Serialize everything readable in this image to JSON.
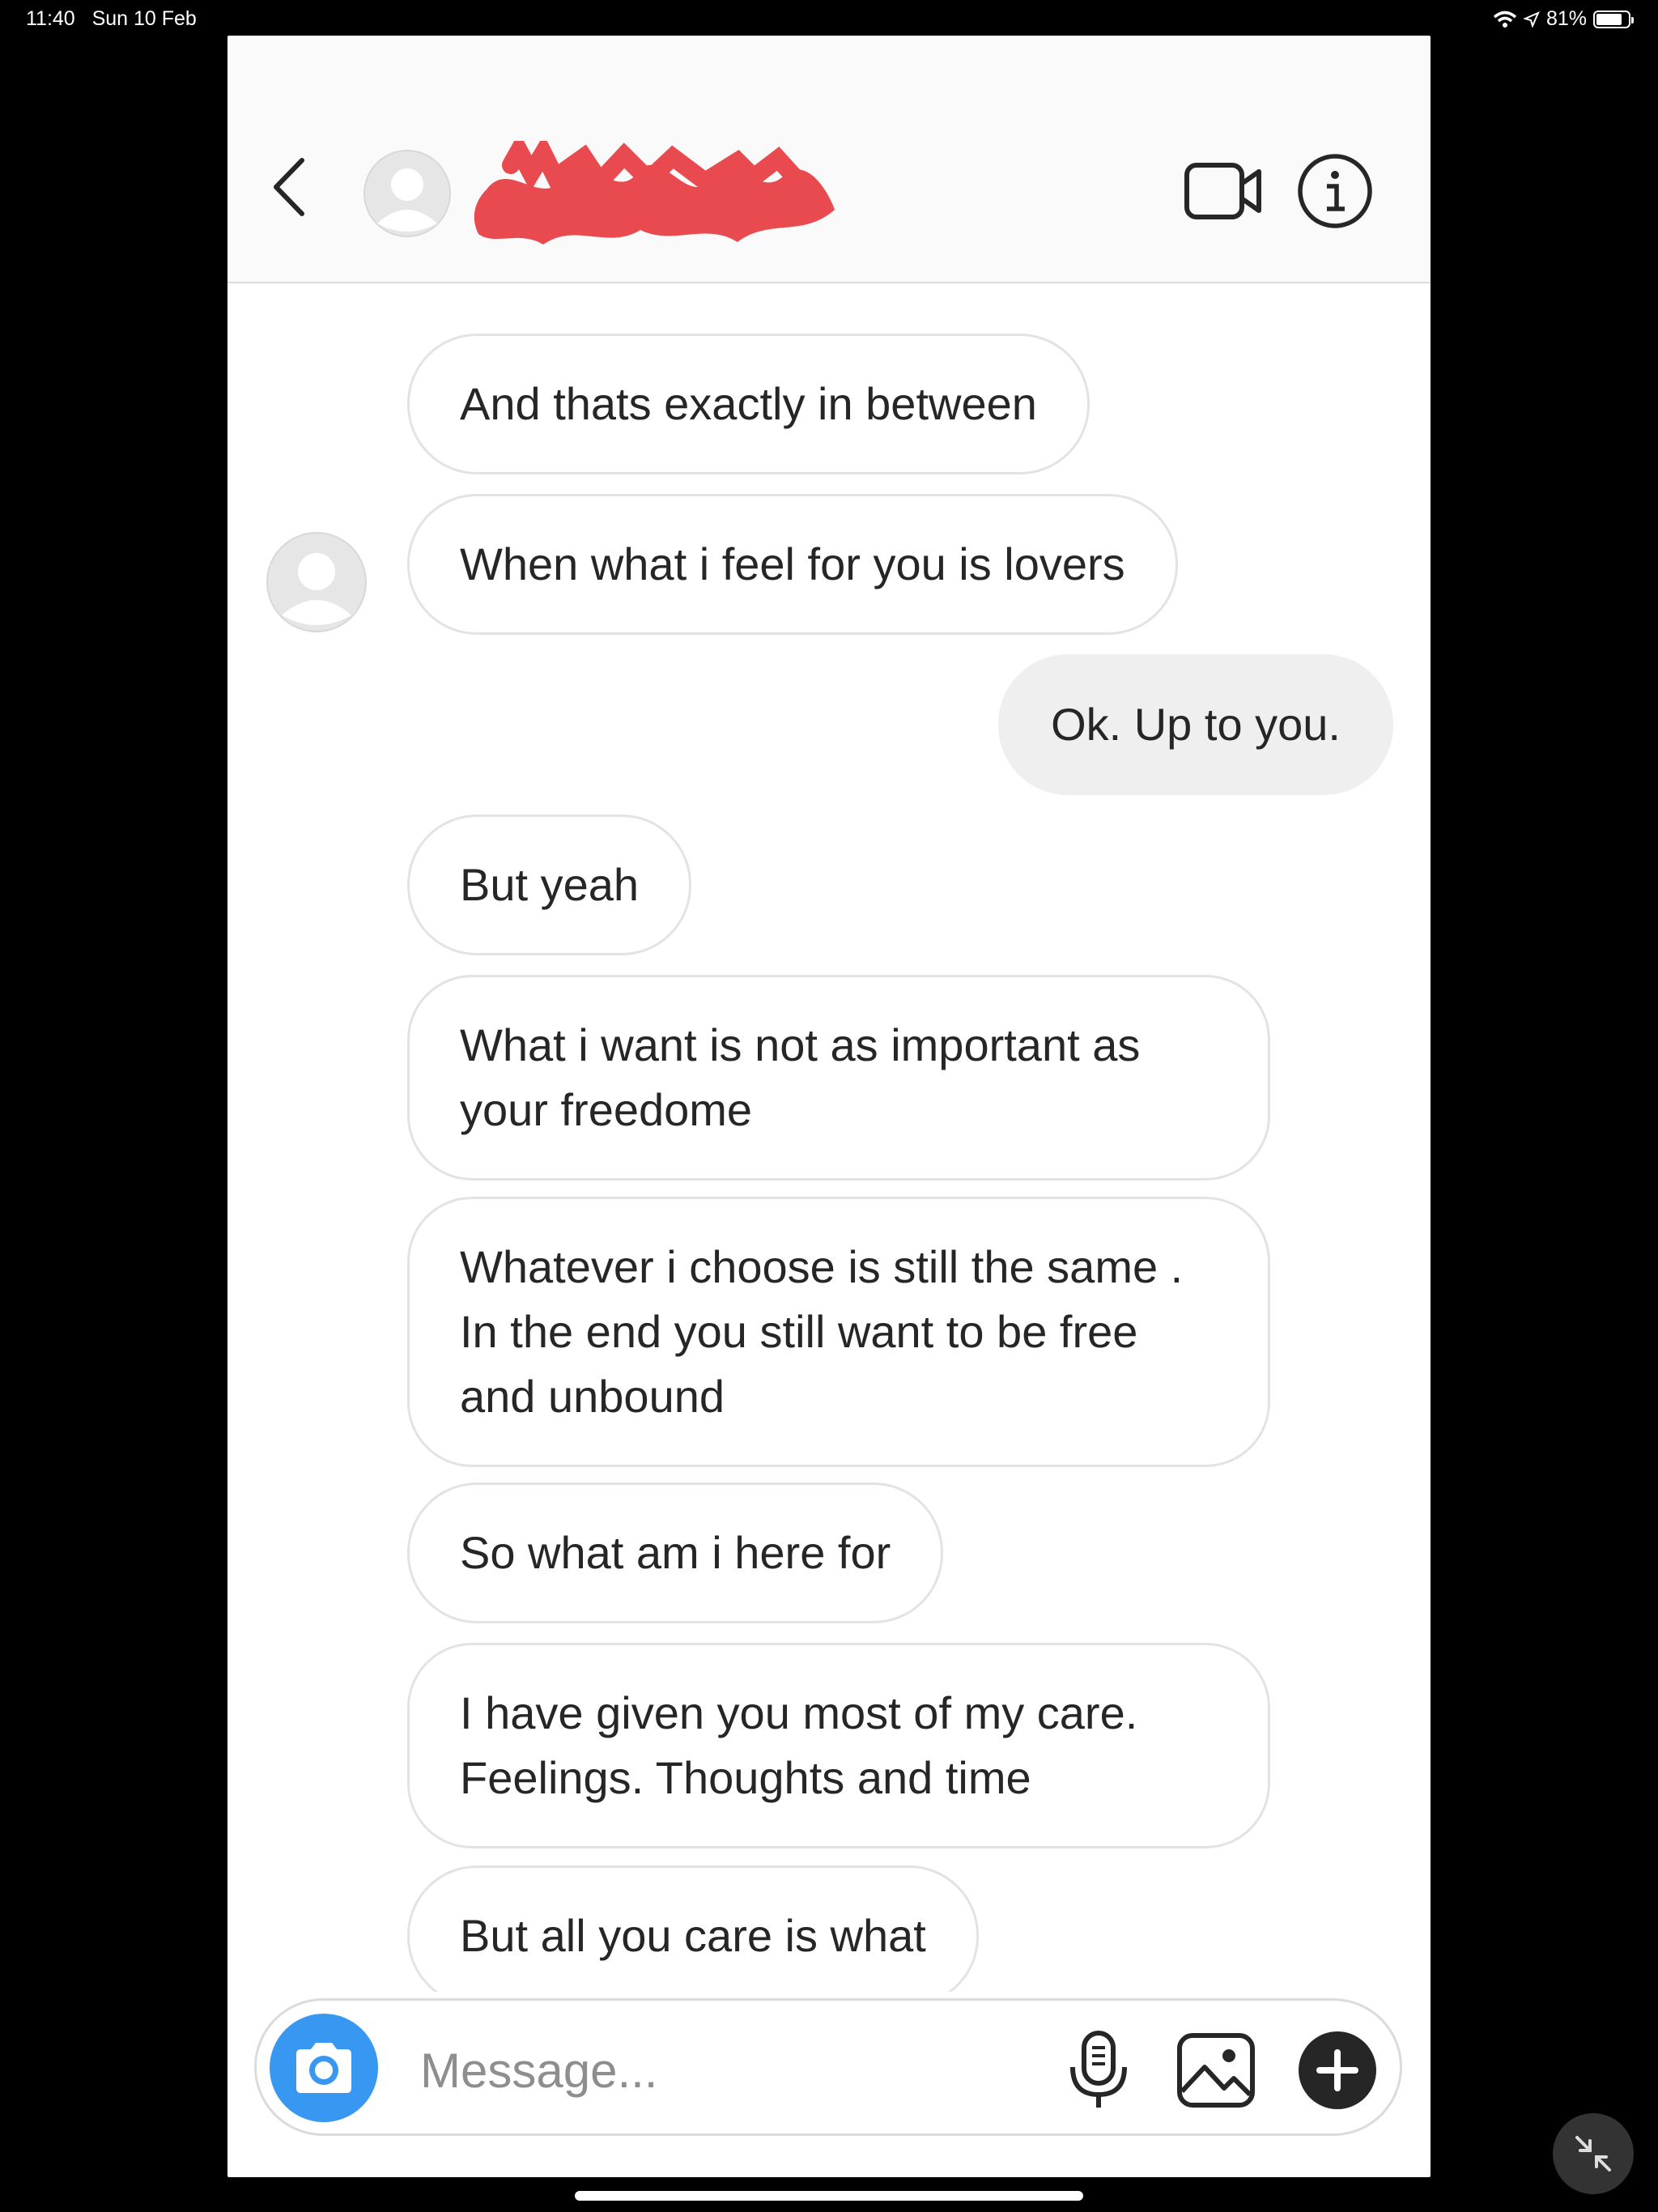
{
  "status_bar": {
    "time": "11:40",
    "date": "Sun 10 Feb",
    "battery_percent": "81%",
    "battery_level": 0.81
  },
  "header": {
    "contact_name_redacted": true,
    "back_icon": "chevron-left-icon",
    "video_icon": "video-camera-icon",
    "info_icon": "info-icon"
  },
  "messages": [
    {
      "text": "And thats exactly in between",
      "sender": "other"
    },
    {
      "text": "When what i feel for you is lovers",
      "sender": "other"
    },
    {
      "text": "Ok. Up to you.",
      "sender": "me"
    },
    {
      "text": "But yeah",
      "sender": "other"
    },
    {
      "text": "What i want is not as important as your freedome",
      "sender": "other"
    },
    {
      "text": "Whatever i choose is still the same .  In the end you still want to be free and unbound",
      "sender": "other"
    },
    {
      "text": "So what am i here for",
      "sender": "other"
    },
    {
      "text": "I have given you most of my care. Feelings.  Thoughts and time",
      "sender": "other"
    },
    {
      "text": "But all you care is what",
      "sender": "other"
    }
  ],
  "composer": {
    "placeholder": "Message...",
    "camera_icon": "camera-icon",
    "mic_icon": "microphone-icon",
    "gallery_icon": "image-icon",
    "plus_icon": "plus-icon"
  },
  "colors": {
    "accent": "#3897f0",
    "redaction": "#e84a50",
    "sent_bubble": "#efefef"
  }
}
